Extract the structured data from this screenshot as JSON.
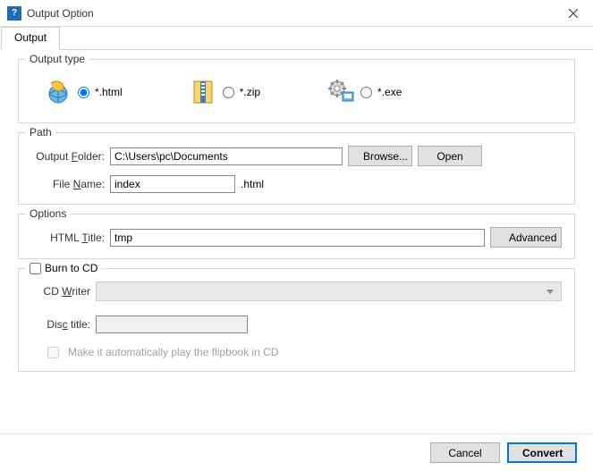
{
  "window": {
    "title": "Output Option"
  },
  "tabs": {
    "output": "Output"
  },
  "outputType": {
    "legend": "Output type",
    "html": "*.html",
    "zip": "*.zip",
    "exe": "*.exe",
    "selected": "html"
  },
  "path": {
    "legend": "Path",
    "folderLabelPre": "Output ",
    "folderLabelUL": "F",
    "folderLabelPost": "older:",
    "folderValue": "C:\\Users\\pc\\Documents",
    "browse": "Browse...",
    "open": "Open",
    "fileLabelPre": "File ",
    "fileLabelUL": "N",
    "fileLabelPost": "ame:",
    "fileValue": "index",
    "ext": ".html"
  },
  "options": {
    "legend": "Options",
    "titleLabelPre": "HTML ",
    "titleLabelUL": "T",
    "titleLabelPost": "itle:",
    "titleValue": "tmp",
    "advanced": "Advanced"
  },
  "burn": {
    "legendPre": "B",
    "legendUL": "u",
    "legendPost": "rn to CD",
    "writerPre": "CD ",
    "writerUL": "W",
    "writerPost": "riter",
    "discPre": "Dis",
    "discUL": "c",
    "discPost": " title:",
    "discValue": "",
    "autoplay": "Make it automatically play the flipbook in CD"
  },
  "footer": {
    "cancel": "Cancel",
    "convert": "Convert"
  }
}
